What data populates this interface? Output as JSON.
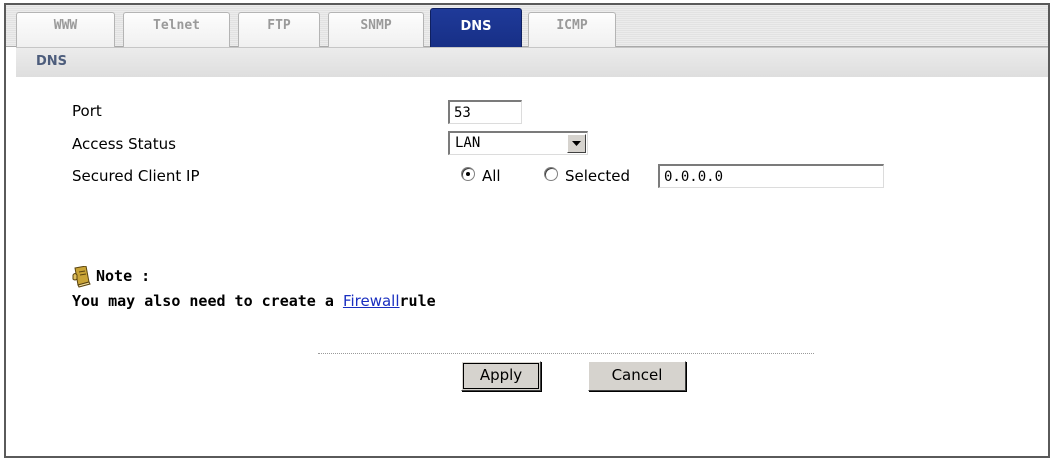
{
  "tabs": [
    {
      "label": "WWW",
      "active": false
    },
    {
      "label": "Telnet",
      "active": false
    },
    {
      "label": "FTP",
      "active": false
    },
    {
      "label": "SNMP",
      "active": false
    },
    {
      "label": "DNS",
      "active": true
    },
    {
      "label": "ICMP",
      "active": false
    }
  ],
  "section": {
    "title": "DNS"
  },
  "form": {
    "port_label": "Port",
    "port_value": "53",
    "access_status_label": "Access Status",
    "access_status_value": "LAN",
    "secured_client_label": "Secured Client IP",
    "radio_all_label": "All",
    "radio_selected_label": "Selected",
    "radio_selected_value": "All",
    "selected_ip_value": "0.0.0.0"
  },
  "note": {
    "title": "Note :",
    "text_prefix": "You may also need to create a ",
    "link": "Firewall",
    "text_suffix": "rule",
    "icon": "note-book-icon"
  },
  "buttons": {
    "apply": "Apply",
    "cancel": "Cancel"
  },
  "colors": {
    "active_tab": "#1f3a99",
    "section_title": "#4d5d7c",
    "link": "#1a2fc0"
  }
}
